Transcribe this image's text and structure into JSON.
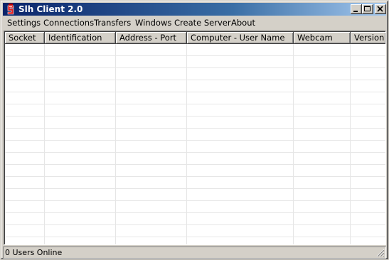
{
  "window": {
    "title": "Slh Client 2.0",
    "icon": "app-icon",
    "controls": [
      "minimize-icon",
      "maximize-icon",
      "close-icon"
    ]
  },
  "menu": {
    "items": [
      "Settings",
      "Connections",
      "Transfers",
      "Windows",
      "Create Server",
      "About"
    ]
  },
  "table": {
    "columns": [
      "Socket",
      "Identification",
      "Address - Port",
      "Computer - User Name",
      "Webcam",
      "Version"
    ],
    "rows": []
  },
  "status": {
    "text": "0 Users Online"
  },
  "colors": {
    "titlebar_start": "#0a246a",
    "titlebar_end": "#a6caf0",
    "face": "#d4d0c8",
    "grid_line": "#e6e6e6"
  }
}
